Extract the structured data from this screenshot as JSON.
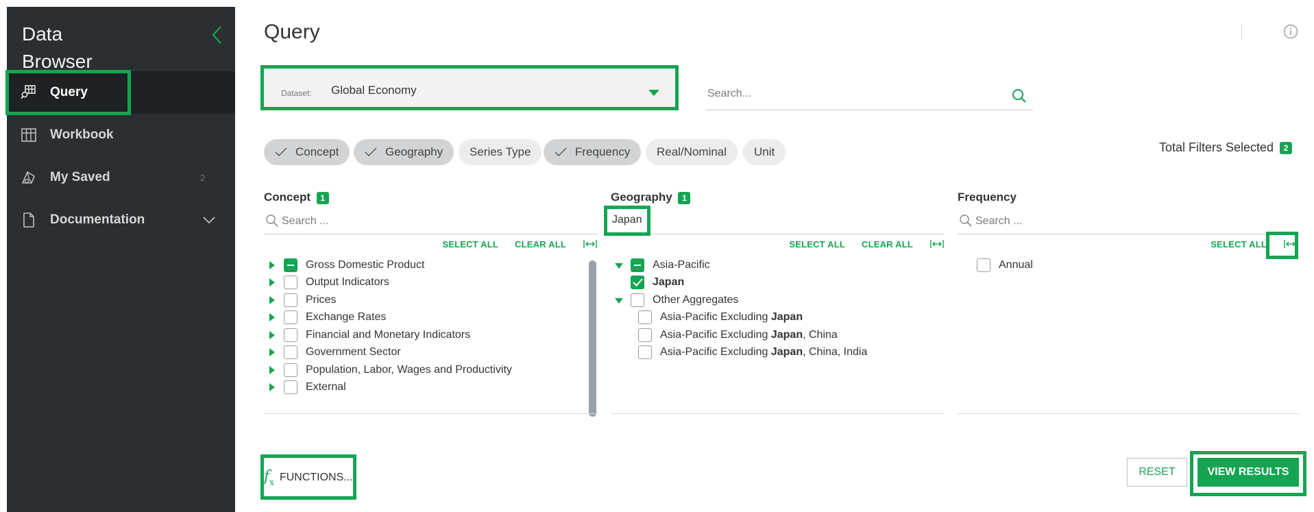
{
  "sidebar": {
    "brand_line1": "Data",
    "brand_line2": "Browser",
    "collapse_icon": "chevron-left-icon",
    "items": [
      {
        "label": "Query",
        "icon": "query-icon",
        "active": true
      },
      {
        "label": "Workbook",
        "icon": "grid-icon"
      },
      {
        "label": "My Saved",
        "icon": "saved-icon",
        "count": "2"
      },
      {
        "label": "Documentation",
        "icon": "document-icon",
        "expandable": true
      }
    ]
  },
  "header": {
    "title": "Query",
    "info_icon": "info-icon"
  },
  "dataset": {
    "label": "Dataset:",
    "value": "Global Economy"
  },
  "search": {
    "placeholder": "Search..."
  },
  "chips": [
    {
      "label": "Concept",
      "selected": true
    },
    {
      "label": "Geography",
      "selected": true
    },
    {
      "label": "Series Type",
      "selected": false
    },
    {
      "label": "Frequency",
      "selected": true
    },
    {
      "label": "Real/Nominal",
      "selected": false
    },
    {
      "label": "Unit",
      "selected": false
    }
  ],
  "total_filters": {
    "label": "Total Filters Selected",
    "count": "2"
  },
  "panels": {
    "concept": {
      "title": "Concept",
      "badge": "1",
      "search_placeholder": "Search ...",
      "select_all": "SELECT ALL",
      "clear_all": "CLEAR ALL",
      "items": [
        "Gross Domestic Product",
        "Output Indicators",
        "Prices",
        "Exchange Rates",
        "Financial and Monetary Indicators",
        "Government Sector",
        "Population, Labor, Wages and Productivity",
        "External"
      ]
    },
    "geography": {
      "title": "Geography",
      "badge": "1",
      "search_value": "Japan",
      "select_all": "SELECT ALL",
      "clear_all": "CLEAR ALL",
      "group1": "Asia-Pacific",
      "item_japan": "Japan",
      "group2": "Other Aggregates",
      "sub_prefix": "Asia-Pacific Excluding ",
      "sub_bold": "Japan",
      "sub2_suffix": ", China",
      "sub3_suffix": ", China, India"
    },
    "frequency": {
      "title": "Frequency",
      "search_placeholder": "Search ...",
      "select_all": "SELECT ALL",
      "items": [
        "Annual"
      ]
    }
  },
  "footer": {
    "functions_label": "FUNCTIONS...",
    "fx_symbol": "f",
    "fx_sub": "x",
    "reset_label": "RESET",
    "view_results_label": "VIEW RESULTS"
  },
  "colors": {
    "accent": "#15a552",
    "sidebar_bg": "#2b2f31",
    "sidebar_active": "#1f2224"
  }
}
